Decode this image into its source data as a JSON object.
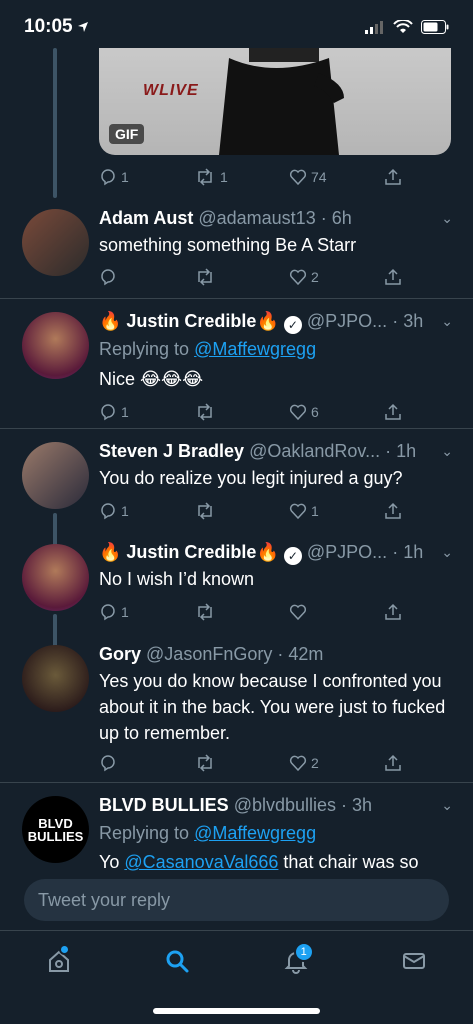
{
  "status_bar": {
    "time": "10:05"
  },
  "media": {
    "badge": "GIF",
    "watermark": "WLIVE"
  },
  "top_actions": {
    "replies": "1",
    "retweets": "1",
    "likes": "74"
  },
  "tweets": [
    {
      "name": "Adam Aust",
      "handle": "@adamaust13",
      "time": "· 6h",
      "text": "something something Be A Starr",
      "replies": "",
      "retweets": "",
      "likes": "2"
    },
    {
      "name": "🔥 Justin Credible🔥",
      "handle": "@PJPO...",
      "time": "· 3h",
      "reply_prefix": "Replying to",
      "reply_to": "@Maffewgregg",
      "text": "Nice 😂😂😂",
      "replies": "1",
      "retweets": "",
      "likes": "6"
    },
    {
      "name": "Steven J Bradley",
      "handle": "@OaklandRov...",
      "time": "· 1h",
      "text": "You do realize you legit injured a guy?",
      "replies": "1",
      "retweets": "",
      "likes": "1"
    },
    {
      "name": "🔥 Justin Credible🔥",
      "handle": "@PJPO...",
      "time": "· 1h",
      "text": "No I wish I’d known",
      "replies": "1",
      "retweets": "",
      "likes": ""
    },
    {
      "name": "Gory",
      "handle": "@JasonFnGory",
      "time": "· 42m",
      "text": "Yes you do know because I confronted you about it in the back. You were just to fucked up to remember.",
      "replies": "",
      "retweets": "",
      "likes": "2"
    },
    {
      "name": "BLVD BULLIES",
      "handle": "@blvdbullies",
      "time": "· 3h",
      "reply_prefix": "Replying to",
      "reply_to": "@Maffewgregg",
      "mention": "@CasanovaVal666",
      "text_suffix": " that chair was so",
      "text_prefix": "Yo "
    }
  ],
  "composer": {
    "placeholder": "Tweet your reply"
  },
  "tabbar": {
    "notifications_count": "1"
  },
  "colors": {
    "background": "#15202b",
    "accent": "#1da1f2",
    "muted": "#8899a6"
  }
}
